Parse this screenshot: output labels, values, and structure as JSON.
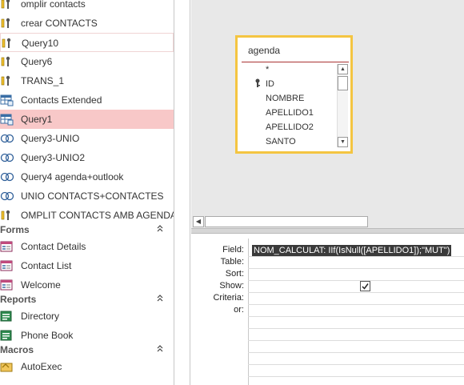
{
  "nav": {
    "items_top": [
      {
        "label": "omplir contacts",
        "icon": "action-query-icon"
      },
      {
        "label": "crear CONTACTS",
        "icon": "action-query-icon"
      },
      {
        "label": "Query10",
        "icon": "action-query-icon"
      },
      {
        "label": "Query6",
        "icon": "action-query-icon"
      },
      {
        "label": "TRANS_1",
        "icon": "action-query-icon"
      },
      {
        "label": "Contacts Extended",
        "icon": "select-query-icon"
      },
      {
        "label": "Query1",
        "icon": "select-query-icon"
      },
      {
        "label": "Query3-UNIO",
        "icon": "union-query-icon"
      },
      {
        "label": "Query3-UNIO2",
        "icon": "union-query-icon"
      },
      {
        "label": "Query4 agenda+outlook",
        "icon": "union-query-icon"
      },
      {
        "label": "UNIO CONTACTS+CONTACTES",
        "icon": "union-query-icon"
      },
      {
        "label": "OMPLIT CONTACTS AMB AGENDA",
        "icon": "action-query-icon"
      }
    ],
    "forms_header": "Forms",
    "forms": [
      {
        "label": "Contact Details",
        "icon": "form-icon"
      },
      {
        "label": "Contact List",
        "icon": "form-icon"
      },
      {
        "label": "Welcome",
        "icon": "form-icon"
      }
    ],
    "reports_header": "Reports",
    "reports": [
      {
        "label": "Directory",
        "icon": "report-icon"
      },
      {
        "label": "Phone Book",
        "icon": "report-icon"
      }
    ],
    "macros_header": "Macros",
    "macros": [
      {
        "label": "AutoExec",
        "icon": "macro-icon"
      }
    ],
    "selected": "Query1",
    "hovered": "Query10",
    "collapse_glyph": "»"
  },
  "table": {
    "name": "agenda",
    "fields": [
      "*",
      "ID",
      "NOMBRE",
      "APELLIDO1",
      "APELLIDO2",
      "SANTO"
    ],
    "key_field": "ID"
  },
  "grid": {
    "row_labels": [
      "Field:",
      "Table:",
      "Sort:",
      "Show:",
      "Criteria:",
      "or:"
    ],
    "field_value": "NOM_CALCULAT: IIf(IsNull([APELLIDO1]);\"MUT\")",
    "show_checked": true
  },
  "colors": {
    "selected_bg": "#f8c8c8",
    "table_border": "#f4c542",
    "design_bg": "#e8e8e8"
  }
}
